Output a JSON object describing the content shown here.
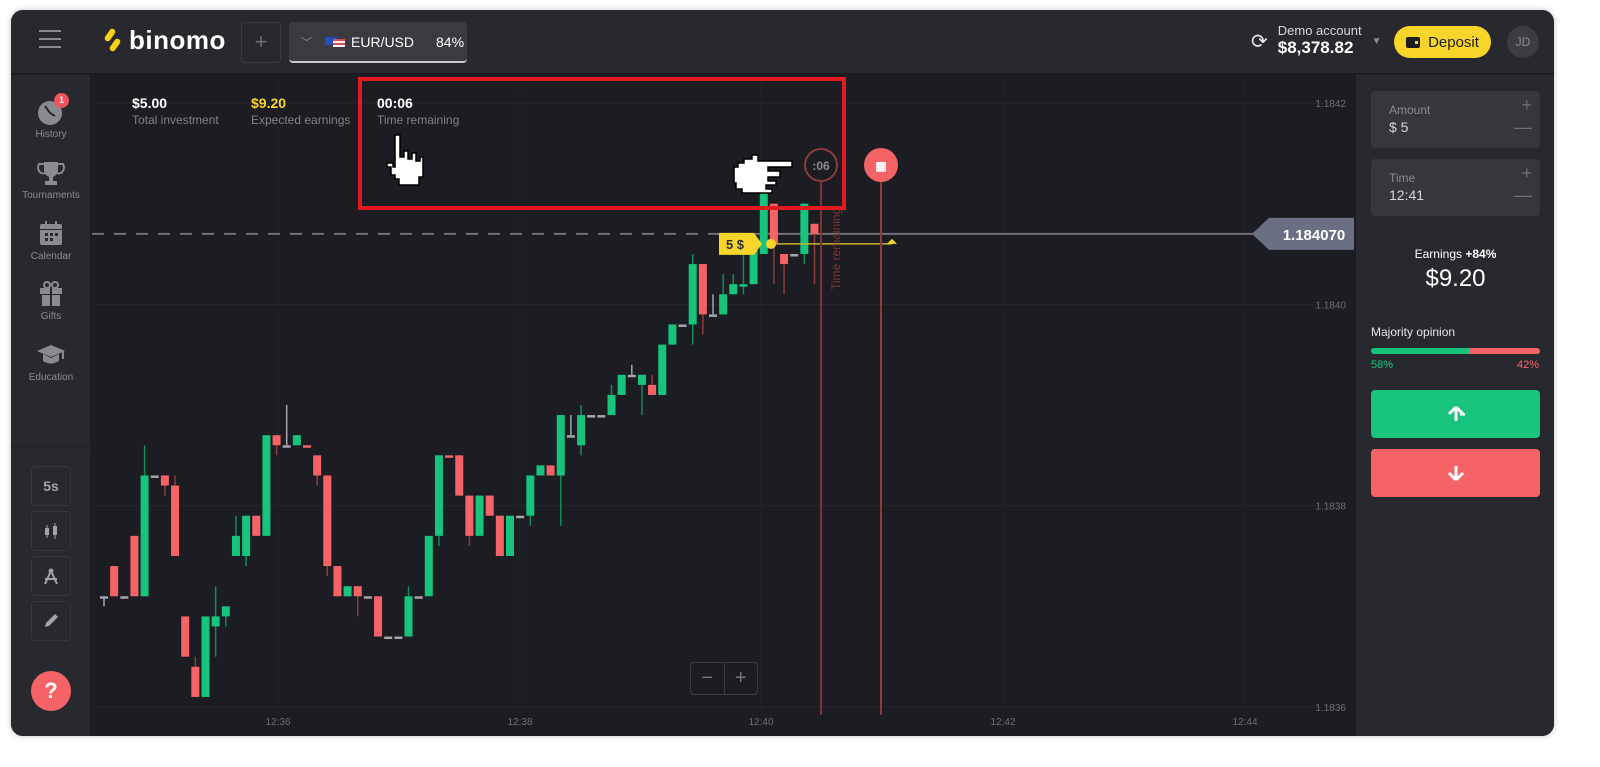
{
  "header": {
    "logo_text": "binomo",
    "add_asset_icon": "plus-icon",
    "asset": {
      "name": "EUR/USD",
      "payout": "84%",
      "flag": "eu-us-flag"
    },
    "account": {
      "label": "Demo account",
      "balance": "$8,378.82"
    },
    "deposit_label": "Deposit",
    "avatar_initials": "JD"
  },
  "sidebar": {
    "items": [
      {
        "label": "History",
        "icon": "clock-icon",
        "badge": "1"
      },
      {
        "label": "Tournaments",
        "icon": "trophy-icon"
      },
      {
        "label": "Calendar",
        "icon": "calendar-icon"
      },
      {
        "label": "Gifts",
        "icon": "gift-icon"
      },
      {
        "label": "Education",
        "icon": "graduation-cap-icon"
      }
    ],
    "tools": [
      {
        "label": "5s",
        "icon": "timeframe"
      },
      {
        "label": "",
        "icon": "candlestick-icon"
      },
      {
        "label": "",
        "icon": "compass-icon"
      },
      {
        "label": "",
        "icon": "pencil-icon"
      }
    ],
    "help_label": "?"
  },
  "stats": {
    "investment": {
      "value": "$5.00",
      "label": "Total investment"
    },
    "expected": {
      "value": "$9.20",
      "label": "Expected earnings"
    },
    "remaining": {
      "value": "00:06",
      "label": "Time remaining"
    }
  },
  "chart_overlay": {
    "timer_badge": ":06",
    "deal_amount": "5 $",
    "time_remaining_label": "Time remaining",
    "current_price": "1.184070",
    "zoom_out": "−",
    "zoom_in": "+"
  },
  "chart_data": {
    "type": "candlestick",
    "title": "EUR/USD",
    "y_ticks": [
      "1.1842",
      "1.1840",
      "1.1838",
      "1.1836"
    ],
    "y_tick_values": [
      1.1842,
      1.184,
      1.1838,
      1.1836
    ],
    "x_ticks": [
      "12:36",
      "12:38",
      "12:40",
      "12:42",
      "12:44"
    ],
    "ylim": [
      1.18351,
      1.18423
    ],
    "current_price": 1.18407,
    "entry_price": 1.18406,
    "expiry_time": "12:41",
    "grid": true,
    "candles": [
      {
        "o": 1.18371,
        "c": 1.18371,
        "h": 1.18371,
        "l": 1.1837
      },
      {
        "o": 1.18371,
        "c": 1.18374,
        "h": 1.18374,
        "l": 1.18371,
        "col": "red"
      },
      {
        "o": 1.18371,
        "c": 1.18371,
        "h": 1.18371,
        "l": 1.18371
      },
      {
        "o": 1.18371,
        "c": 1.18377,
        "h": 1.18377,
        "l": 1.18371,
        "col": "red"
      },
      {
        "o": 1.18371,
        "c": 1.18383,
        "h": 1.18386,
        "l": 1.18371,
        "col": "green"
      },
      {
        "o": 1.18383,
        "c": 1.18383,
        "h": 1.18383,
        "l": 1.18383
      },
      {
        "o": 1.18382,
        "c": 1.18383,
        "h": 1.18383,
        "l": 1.18381,
        "col": "red"
      },
      {
        "o": 1.18375,
        "c": 1.18382,
        "h": 1.18383,
        "l": 1.18375,
        "col": "red"
      },
      {
        "o": 1.18365,
        "c": 1.18369,
        "h": 1.18369,
        "l": 1.18365,
        "col": "red"
      },
      {
        "o": 1.18361,
        "c": 1.18364,
        "h": 1.18365,
        "l": 1.18361,
        "col": "red"
      },
      {
        "o": 1.18361,
        "c": 1.18369,
        "h": 1.18369,
        "l": 1.18361,
        "col": "green"
      },
      {
        "o": 1.18368,
        "c": 1.18369,
        "h": 1.18372,
        "l": 1.18365,
        "col": "green"
      },
      {
        "o": 1.18369,
        "c": 1.1837,
        "h": 1.1837,
        "l": 1.18368,
        "col": "green"
      },
      {
        "o": 1.18375,
        "c": 1.18377,
        "h": 1.18379,
        "l": 1.18375,
        "col": "green"
      },
      {
        "o": 1.18375,
        "c": 1.18379,
        "h": 1.18379,
        "l": 1.18374,
        "col": "green"
      },
      {
        "o": 1.18377,
        "c": 1.18379,
        "h": 1.18379,
        "l": 1.18377,
        "col": "red"
      },
      {
        "o": 1.18377,
        "c": 1.18387,
        "h": 1.18387,
        "l": 1.18377,
        "col": "green"
      },
      {
        "o": 1.18386,
        "c": 1.18387,
        "h": 1.18387,
        "l": 1.18385,
        "col": "red"
      },
      {
        "o": 1.18386,
        "c": 1.18386,
        "h": 1.1839,
        "l": 1.18386
      },
      {
        "o": 1.18386,
        "c": 1.18387,
        "h": 1.18387,
        "l": 1.18386,
        "col": "green"
      },
      {
        "o": 1.18386,
        "c": 1.18386,
        "h": 1.18386,
        "l": 1.18386,
        "col": "red"
      },
      {
        "o": 1.18383,
        "c": 1.18385,
        "h": 1.18385,
        "l": 1.18382,
        "col": "red"
      },
      {
        "o": 1.18374,
        "c": 1.18383,
        "h": 1.18383,
        "l": 1.18373,
        "col": "red"
      },
      {
        "o": 1.18371,
        "c": 1.18374,
        "h": 1.18374,
        "l": 1.18371,
        "col": "red"
      },
      {
        "o": 1.18371,
        "c": 1.18372,
        "h": 1.18372,
        "l": 1.18371,
        "col": "green"
      },
      {
        "o": 1.18371,
        "c": 1.18372,
        "h": 1.18372,
        "l": 1.18369,
        "col": "red"
      },
      {
        "o": 1.18371,
        "c": 1.18371,
        "h": 1.18371,
        "l": 1.18371
      },
      {
        "o": 1.18367,
        "c": 1.18371,
        "h": 1.18371,
        "l": 1.18367,
        "col": "red"
      },
      {
        "o": 1.18367,
        "c": 1.18367,
        "h": 1.18367,
        "l": 1.18367
      },
      {
        "o": 1.18367,
        "c": 1.18367,
        "h": 1.18367,
        "l": 1.18367
      },
      {
        "o": 1.18367,
        "c": 1.18371,
        "h": 1.18372,
        "l": 1.18367,
        "col": "green"
      },
      {
        "o": 1.18371,
        "c": 1.18371,
        "h": 1.18371,
        "l": 1.18371
      },
      {
        "o": 1.18371,
        "c": 1.18377,
        "h": 1.18377,
        "l": 1.18371,
        "col": "green"
      },
      {
        "o": 1.18377,
        "c": 1.18385,
        "h": 1.18385,
        "l": 1.18376,
        "col": "green"
      },
      {
        "o": 1.18385,
        "c": 1.18385,
        "h": 1.18385,
        "l": 1.18385,
        "col": "red"
      },
      {
        "o": 1.18381,
        "c": 1.18385,
        "h": 1.18385,
        "l": 1.18381,
        "col": "red"
      },
      {
        "o": 1.18377,
        "c": 1.18381,
        "h": 1.18381,
        "l": 1.18376,
        "col": "red"
      },
      {
        "o": 1.18377,
        "c": 1.18381,
        "h": 1.18381,
        "l": 1.18377,
        "col": "green"
      },
      {
        "o": 1.18379,
        "c": 1.18381,
        "h": 1.18381,
        "l": 1.18379,
        "col": "red"
      },
      {
        "o": 1.18375,
        "c": 1.18379,
        "h": 1.18379,
        "l": 1.18375,
        "col": "red"
      },
      {
        "o": 1.18375,
        "c": 1.18379,
        "h": 1.18379,
        "l": 1.18375,
        "col": "green"
      },
      {
        "o": 1.18379,
        "c": 1.18379,
        "h": 1.18379,
        "l": 1.18379
      },
      {
        "o": 1.18379,
        "c": 1.18383,
        "h": 1.18383,
        "l": 1.18378,
        "col": "green"
      },
      {
        "o": 1.18383,
        "c": 1.18384,
        "h": 1.18384,
        "l": 1.18383,
        "col": "green"
      },
      {
        "o": 1.18383,
        "c": 1.18384,
        "h": 1.18384,
        "l": 1.18383,
        "col": "red"
      },
      {
        "o": 1.18383,
        "c": 1.18389,
        "h": 1.18389,
        "l": 1.18378,
        "col": "green"
      },
      {
        "o": 1.18387,
        "c": 1.18387,
        "h": 1.18389,
        "l": 1.18387
      },
      {
        "o": 1.18386,
        "c": 1.18389,
        "h": 1.1839,
        "l": 1.18385,
        "col": "green"
      },
      {
        "o": 1.18389,
        "c": 1.18389,
        "h": 1.18389,
        "l": 1.18389
      },
      {
        "o": 1.18389,
        "c": 1.18389,
        "h": 1.18389,
        "l": 1.18389
      },
      {
        "o": 1.18389,
        "c": 1.18391,
        "h": 1.18392,
        "l": 1.18389,
        "col": "green"
      },
      {
        "o": 1.18391,
        "c": 1.18393,
        "h": 1.18393,
        "l": 1.18391,
        "col": "green"
      },
      {
        "o": 1.18393,
        "c": 1.18393,
        "h": 1.18394,
        "l": 1.18393
      },
      {
        "o": 1.18392,
        "c": 1.18393,
        "h": 1.18393,
        "l": 1.18389,
        "col": "green"
      },
      {
        "o": 1.18391,
        "c": 1.18392,
        "h": 1.18393,
        "l": 1.18391,
        "col": "red"
      },
      {
        "o": 1.18391,
        "c": 1.18396,
        "h": 1.18396,
        "l": 1.18391,
        "col": "green"
      },
      {
        "o": 1.18396,
        "c": 1.18398,
        "h": 1.18398,
        "l": 1.18396,
        "col": "green"
      },
      {
        "o": 1.18398,
        "c": 1.18398,
        "h": 1.18398,
        "l": 1.18398
      },
      {
        "o": 1.18398,
        "c": 1.18404,
        "h": 1.18405,
        "l": 1.18396,
        "col": "green"
      },
      {
        "o": 1.18399,
        "c": 1.18404,
        "h": 1.18404,
        "l": 1.18397,
        "col": "red"
      },
      {
        "o": 1.18399,
        "c": 1.18399,
        "h": 1.18401,
        "l": 1.18399
      },
      {
        "o": 1.18399,
        "c": 1.18401,
        "h": 1.18403,
        "l": 1.18399,
        "col": "green"
      },
      {
        "o": 1.18401,
        "c": 1.18402,
        "h": 1.18403,
        "l": 1.18401,
        "col": "green"
      },
      {
        "o": 1.18402,
        "c": 1.18402,
        "h": 1.18405,
        "l": 1.18401,
        "col": "green"
      },
      {
        "o": 1.18402,
        "c": 1.18406,
        "h": 1.18407,
        "l": 1.18402,
        "col": "green"
      },
      {
        "o": 1.18405,
        "c": 1.18411,
        "h": 1.18411,
        "l": 1.18405,
        "col": "green"
      },
      {
        "o": 1.18406,
        "c": 1.1841,
        "h": 1.1841,
        "l": 1.18402,
        "col": "red"
      },
      {
        "o": 1.18404,
        "c": 1.18405,
        "h": 1.18405,
        "l": 1.18401,
        "col": "red"
      },
      {
        "o": 1.18405,
        "c": 1.18405,
        "h": 1.18405,
        "l": 1.18405
      },
      {
        "o": 1.18405,
        "c": 1.1841,
        "h": 1.1841,
        "l": 1.18404,
        "col": "green"
      },
      {
        "o": 1.18407,
        "c": 1.18408,
        "h": 1.18408,
        "l": 1.18402,
        "col": "red"
      }
    ]
  },
  "right_panel": {
    "amount": {
      "label": "Amount",
      "value": "$ 5"
    },
    "time": {
      "label": "Time",
      "value": "12:41"
    },
    "earnings_label": "Earnings",
    "earnings_pct": "+84%",
    "earnings_value": "$9.20",
    "majority": {
      "label": "Majority opinion",
      "up_pct": 58,
      "down_pct": 42,
      "up_label": "58%",
      "down_label": "42%"
    },
    "up_icon": "arrow-up-icon",
    "down_icon": "arrow-down-icon",
    "up_glyph": "🡑",
    "down_glyph": "🡓"
  },
  "colors": {
    "up": "#17c37d",
    "down": "#f56367",
    "accent": "#f8d52b",
    "highlight": "#e21b23"
  }
}
